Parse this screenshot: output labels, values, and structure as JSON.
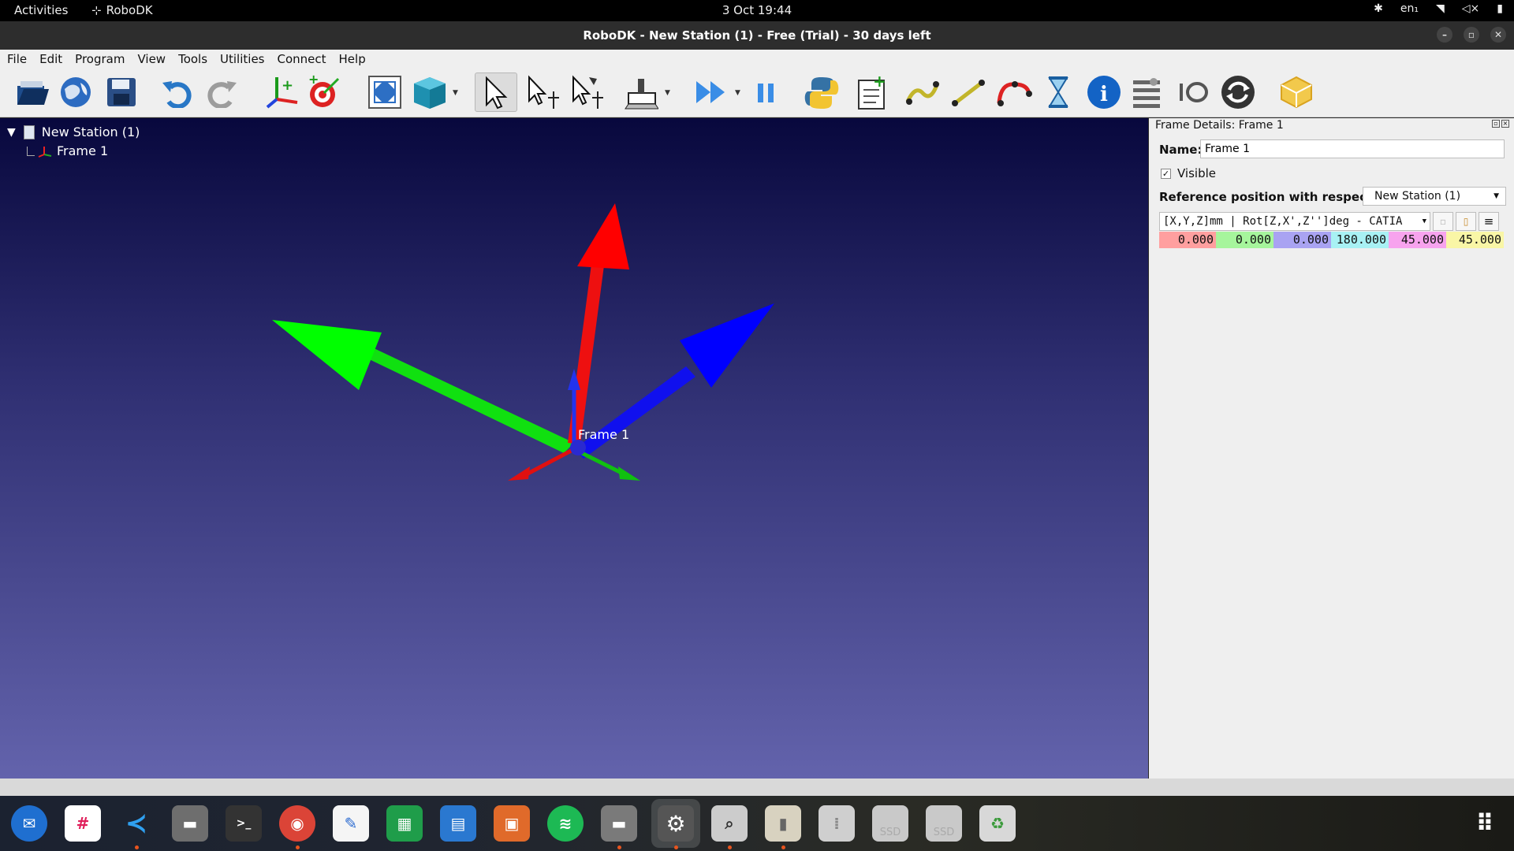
{
  "topbar": {
    "activities": "Activities",
    "app_name": "RoboDK",
    "clock": "3 Oct  19:44",
    "keyboard_layout": "en₁"
  },
  "window": {
    "title": "RoboDK - New Station (1) - Free (Trial) - 30 days left"
  },
  "menu": [
    "File",
    "Edit",
    "Program",
    "View",
    "Tools",
    "Utilities",
    "Connect",
    "Help"
  ],
  "toolbar": {
    "icons": [
      "open-icon",
      "web-library-icon",
      "save-icon",
      "undo-icon",
      "redo-icon",
      "add-reference-frame-icon",
      "add-target-icon",
      "fit-all-icon",
      "view-iso-icon",
      "select-icon",
      "move-reference-icon",
      "move-tool-icon",
      "add-tool-icon",
      "run-simulation-icon",
      "pause-icon",
      "python-icon",
      "add-program-icon",
      "move-joint-icon",
      "move-linear-icon",
      "move-circular-icon",
      "pause-instruction-icon",
      "message-icon",
      "set-io-icon",
      "io-icon",
      "call-program-icon",
      "collision-icon"
    ]
  },
  "tree": {
    "root": "New Station (1)",
    "child": "Frame 1"
  },
  "viewport": {
    "frame_label": "Frame 1",
    "gradient_top": "#08083d",
    "gradient_bottom": "#6363ac"
  },
  "panel": {
    "title": "Frame Details: Frame 1",
    "name_label": "Name:",
    "name_value": "Frame 1",
    "visible_label": "Visible",
    "visible_checked": true,
    "ref_label": "Reference position with respect to:",
    "ref_value": "New Station (1)",
    "format_value": "[X,Y,Z]mm | Rot[Z,X',Z'']deg - CATIA",
    "values": [
      {
        "text": "0.000",
        "color": "#ff9f9f"
      },
      {
        "text": "0.000",
        "color": "#a6f59c"
      },
      {
        "text": "0.000",
        "color": "#a9a3f2"
      },
      {
        "text": "180.000",
        "color": "#a8f1f4"
      },
      {
        "text": "45.000",
        "color": "#f7a3ee"
      },
      {
        "text": "45.000",
        "color": "#f9f6a6"
      }
    ]
  },
  "dock": {
    "apps": [
      "thunderbird-icon",
      "slack-icon",
      "vscode-icon",
      "files-icon",
      "terminal-icon",
      "chrome-icon",
      "text-editor-icon",
      "spreadsheet-icon",
      "writer-icon",
      "impress-icon",
      "spotify-icon",
      "files-2-icon",
      "settings-icon",
      "image-viewer-icon",
      "archive-icon",
      "disk-icon",
      "ssd-icon",
      "ssd-2-icon",
      "trash-icon"
    ],
    "ssd_label": "SSD"
  }
}
